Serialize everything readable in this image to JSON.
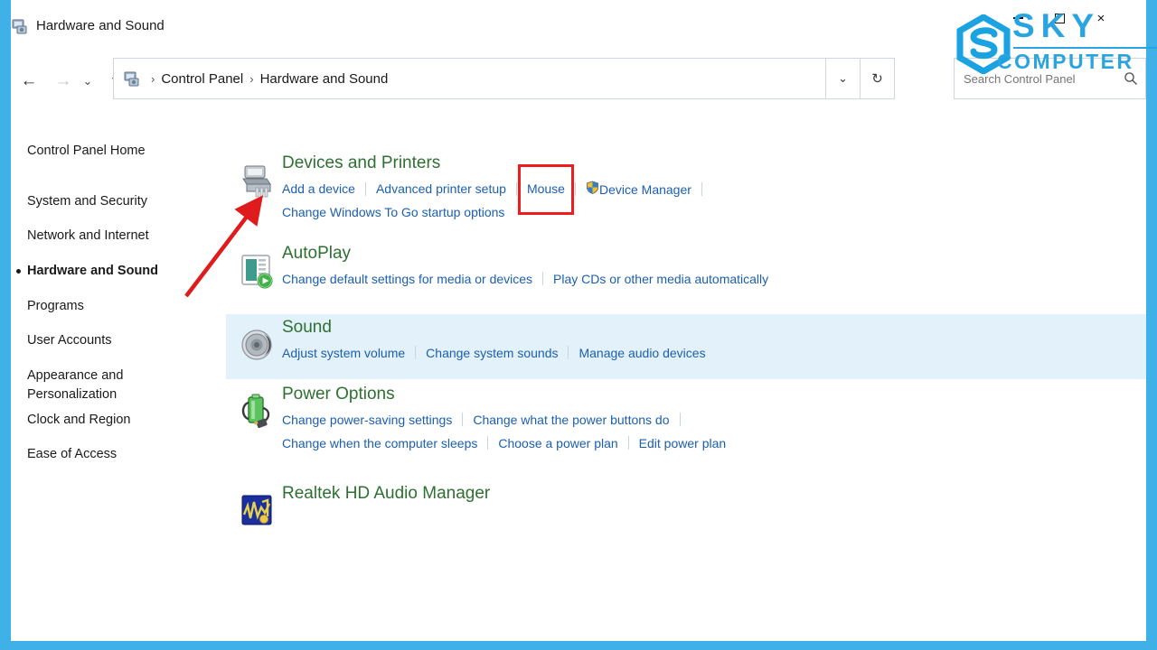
{
  "window": {
    "title": "Hardware and Sound",
    "title_icon": "hardware-and-sound-icon",
    "controls": {
      "minimize": "–",
      "maximize": "❐",
      "close": "×"
    }
  },
  "navigation": {
    "back": "←",
    "forward": "→",
    "recent": "⌄",
    "up": "↑",
    "refresh": "↻",
    "dropdown": "⌄"
  },
  "breadcrumb": {
    "icon": "control-panel-icon",
    "separator": "›",
    "items": [
      "Control Panel",
      "Hardware and Sound"
    ]
  },
  "search": {
    "placeholder": "Search Control Panel",
    "value": "",
    "icon": "search-icon"
  },
  "sidebar": {
    "home": "Control Panel Home",
    "items": [
      {
        "label": "System and Security",
        "current": false
      },
      {
        "label": "Network and Internet",
        "current": false
      },
      {
        "label": "Hardware and Sound",
        "current": true
      },
      {
        "label": "Programs",
        "current": false
      },
      {
        "label": "User Accounts",
        "current": false
      },
      {
        "label": "Appearance and Personalization",
        "current": false
      },
      {
        "label": "Clock and Region",
        "current": false
      },
      {
        "label": "Ease of Access",
        "current": false
      }
    ]
  },
  "categories": [
    {
      "title": "Devices and Printers",
      "icon": "printer-icon",
      "highlighted": false,
      "row1": [
        {
          "label": "Add a device",
          "shield": false
        },
        {
          "label": "Advanced printer setup",
          "shield": false
        },
        {
          "label": "Mouse",
          "shield": false
        },
        {
          "label": "Device Manager",
          "shield": true
        }
      ],
      "row1_trailing_separator": true,
      "row2": [
        {
          "label": "Change Windows To Go startup options",
          "shield": false
        }
      ]
    },
    {
      "title": "AutoPlay",
      "icon": "autoplay-icon",
      "highlighted": false,
      "row1": [
        {
          "label": "Change default settings for media or devices",
          "shield": false
        },
        {
          "label": "Play CDs or other media automatically",
          "shield": false
        }
      ],
      "row1_trailing_separator": false,
      "row2": []
    },
    {
      "title": "Sound",
      "icon": "speaker-icon",
      "highlighted": true,
      "row1": [
        {
          "label": "Adjust system volume",
          "shield": false
        },
        {
          "label": "Change system sounds",
          "shield": false
        },
        {
          "label": "Manage audio devices",
          "shield": false
        }
      ],
      "row1_trailing_separator": false,
      "row2": []
    },
    {
      "title": "Power Options",
      "icon": "battery-icon",
      "highlighted": false,
      "row1": [
        {
          "label": "Change power-saving settings",
          "shield": false
        },
        {
          "label": "Change what the power buttons do",
          "shield": false
        }
      ],
      "row1_trailing_separator": true,
      "row2": [
        {
          "label": "Change when the computer sleeps",
          "shield": false
        },
        {
          "label": "Choose a power plan",
          "shield": false
        },
        {
          "label": "Edit power plan",
          "shield": false
        }
      ]
    },
    {
      "title": "Realtek HD Audio Manager",
      "icon": "realtek-audio-icon",
      "highlighted": false,
      "row1": [],
      "row1_trailing_separator": false,
      "row2": []
    }
  ],
  "annotations": {
    "highlight_box_target": "Mouse",
    "highlight_box_color": "#ee1c1c",
    "arrow_color": "#e01b1b",
    "arrow_target": "Devices and Printers icon"
  },
  "watermark": {
    "line1": "SKY",
    "line2": "COMPUTER",
    "color": "#2aa4e0",
    "logo": "sky-hexagon-logo"
  },
  "colors": {
    "frame": "#3fb0e8",
    "heading": "#2e7031",
    "link": "#1b5fae",
    "row_highlight": "#e3f1fb"
  }
}
